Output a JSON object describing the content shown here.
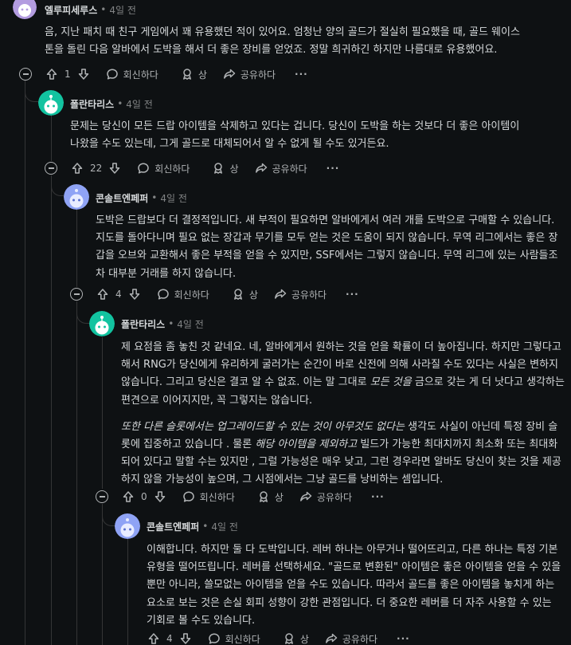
{
  "comments": [
    {
      "author": "엘루피세루스",
      "time": "4일 전",
      "paragraphs": [
        [
          {
            "t": "음, 지난 패치 때 친구 게임에서 꽤 유용했던 적이 있어요. 엄청난 양의 골드가 절실히 필요했을 때, 골드 웨이스톤을 돌린 다음 알바에서 도박을 해서 더 좋은 장비를 얻었죠. 정말 희귀하긴 하지만 나름대로 유용했어요."
          }
        ]
      ],
      "votes": "1"
    },
    {
      "author": "폴란타리스",
      "time": "4일 전",
      "paragraphs": [
        [
          {
            "t": "문제는 당신이 모든 드랍 아이템을 삭제하고 있다는 겁니다. 당신이 도박을 하는 것보다 더 좋은 아이템이 나왔을 수도 있는데, 그게 골드로 대체되어서 알 수 없게 될 수도 있거든요."
          }
        ]
      ],
      "votes": "22"
    },
    {
      "author": "콘솔트엔페퍼",
      "time": "4일 전",
      "paragraphs": [
        [
          {
            "t": "도박은 드랍보다 더 결정적입니다. 새 부적이 필요하면 알바에게서 여러 개를 도박으로 구매할 수 있습니다. 지도를 돌아다니며 필요 없는 장갑과 무기를 모두 얻는 것은 도움이 되지 않습니다. 무역 리그에서는 좋은 장갑을 오브와 교환해서 좋은 부적을 얻을 수 있지만, SSF에서는 그렇지 않습니다. 무역 리그에 있는 사람들조차 대부분 거래를 하지 않습니다."
          }
        ]
      ],
      "votes": "4"
    },
    {
      "author": "폴란타리스",
      "time": "4일 전",
      "paragraphs": [
        [
          {
            "t": "제 요점을 좀 놓친 것 같네요. 네, 알바에게서 원하는 것을 얻을 확률이 더 높아집니다. 하지만 그렇다고 해서 RNG가 당신에게 유리하게 굴러가는 순간이 바로 신전에 의해 사라질 수도 있다는 사실은 변하지 않습니다. 그리고 당신은 결코 알 수 없죠. 이는 말 그대로 "
          },
          {
            "t": "모든 것을",
            "i": true
          },
          {
            "t": " 금으로 갖는 게 더 낫다고 생각하는 편견으로 이어지지만, 꼭 그렇지는 않습니다."
          }
        ],
        [
          {
            "t": "또한 다른 슬롯에서는 업그레이드할 수 있는 것이 아무것도 없다는",
            "i": true
          },
          {
            "t": " 생각도 사실이 아닌데 특정 장비 슬롯에 집중하고 있습니다 . 물론 "
          },
          {
            "t": "해당 아이템을 제외하고",
            "i": true
          },
          {
            "t": " 빌드가 가능한 최대치까지 최소화 또는 최대화되어 있다고 말할 수는 있지만 , 그럴 가능성은 매우 낮고, 그런 경우라면 알바도 당신이 찾는 것을 제공하지 않을 가능성이 높으며, 그 시점에서는 그냥 골드를 낭비하는 셈입니다."
          }
        ]
      ],
      "votes": "0"
    },
    {
      "author": "콘솔트엔페퍼",
      "time": "4일 전",
      "paragraphs": [
        [
          {
            "t": "이해합니다. 하지만 둘 다 도박입니다. 레버 하나는 아무거나 떨어뜨리고, 다른 하나는 특정 기본 유형을 떨어뜨립니다. 레버를 선택하세요. \"골드로 변환된\" 아이템은 좋은 아이템을 얻을 수 있을 뿐만 아니라, 쓸모없는 아이템을 얻을 수도 있습니다. 따라서 골드를 좋은 아이템을 놓치게 하는 요소로 보는 것은 손실 회피 성향이 강한 관점입니다. 더 중요한 레버를 더 자주 사용할 수 있는 기회로 볼 수도 있습니다."
          }
        ]
      ],
      "votes": "4"
    }
  ],
  "actions": {
    "reply": "회신하다",
    "award": "상",
    "share": "공유하다",
    "more": "···"
  },
  "icons": {
    "upvote": "arrow-up-icon",
    "downvote": "arrow-down-icon",
    "reply": "speech-bubble-icon",
    "award": "award-icon",
    "share": "share-arrow-icon",
    "collapse": "minus-circle-icon"
  },
  "colors": {
    "background": "#0e1113",
    "text": "#d7dadc",
    "muted": "#818384",
    "thread_line": "#343536",
    "avatar_green": "#12c3a0",
    "avatar_purple": "#b39ce0",
    "avatar_blue": "#8fa3f5"
  }
}
